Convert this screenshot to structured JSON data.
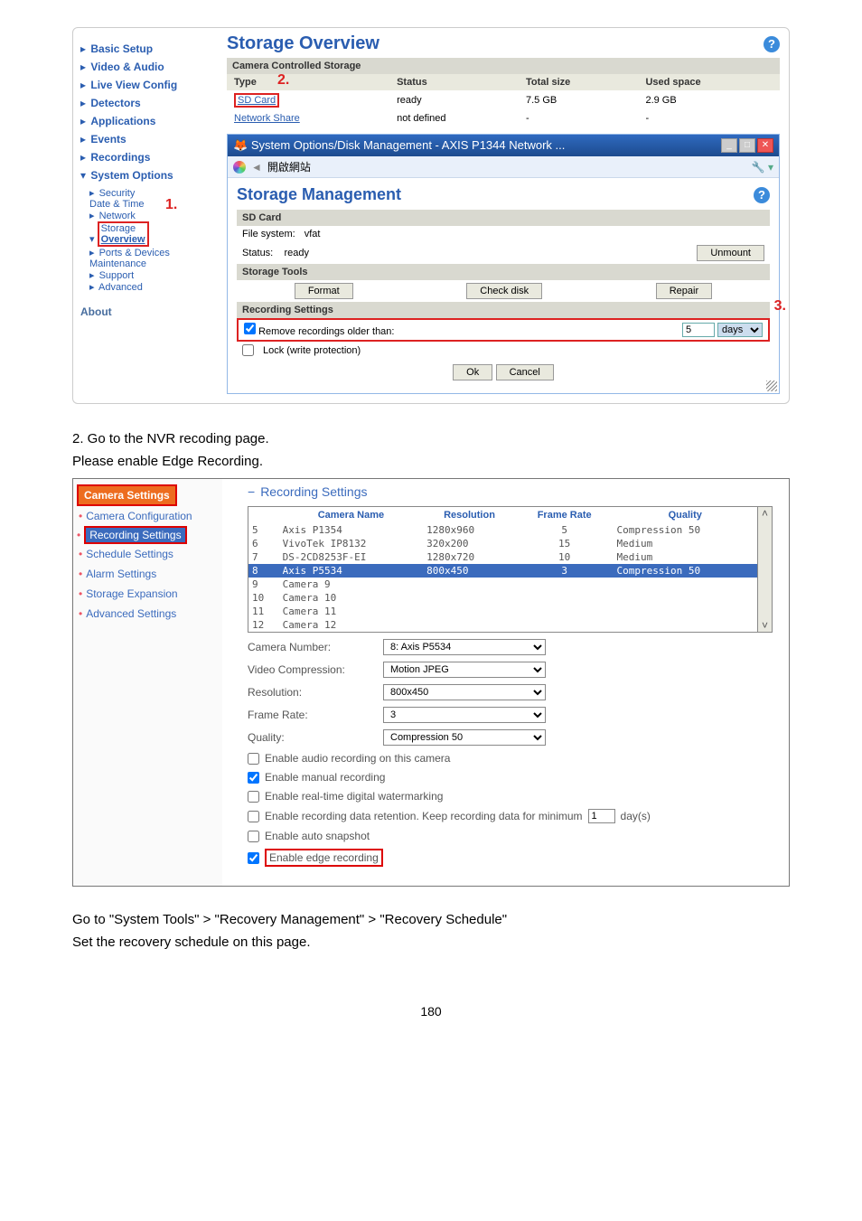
{
  "shot1": {
    "leftnav": {
      "items": [
        "Basic Setup",
        "Video & Audio",
        "Live View Config",
        "Detectors",
        "Applications",
        "Events",
        "Recordings"
      ],
      "sysopt_label": "System Options",
      "sysopt_children": {
        "security": "Security",
        "datetime": "Date & Time",
        "network": "Network",
        "storage": "Storage",
        "overview": "Overview",
        "ports": "Ports & Devices",
        "maintenance": "Maintenance",
        "support": "Support",
        "advanced": "Advanced"
      },
      "about": "About"
    },
    "title": "Storage Overview",
    "cam_storage_hdr": "Camera Controlled Storage",
    "table": {
      "headers": [
        "Type",
        "Status",
        "Total size",
        "Used space"
      ],
      "rows": [
        {
          "type": "SD Card",
          "status": "ready",
          "total": "7.5 GB",
          "used": "2.9 GB"
        },
        {
          "type": "Network Share",
          "status": "not defined",
          "total": "-",
          "used": "-"
        }
      ]
    },
    "anno2": "2.",
    "anno1": "1.",
    "anno3": "3.",
    "dialog": {
      "title": "System Options/Disk Management - AXIS P1344 Network ...",
      "toolbar_label": "開啟網站",
      "mgmt_title": "Storage Management",
      "sdcard_hdr": "SD Card",
      "fs_label": "File system:",
      "fs_value": "vfat",
      "status_label": "Status:",
      "status_value": "ready",
      "unmount_btn": "Unmount",
      "tools_hdr": "Storage Tools",
      "format_btn": "Format",
      "check_btn": "Check disk",
      "repair_btn": "Repair",
      "rec_hdr": "Recording Settings",
      "remove_label": "Remove recordings older than:",
      "remove_value": "5",
      "remove_unit": "days",
      "lock_label": "Lock (write protection)",
      "ok": "Ok",
      "cancel": "Cancel"
    }
  },
  "bodytext": {
    "line1": "2. Go to the NVR recoding page.",
    "line2": "Please enable Edge Recording."
  },
  "shot2": {
    "leftnav": {
      "hdr": "Camera Settings",
      "items": [
        "Camera Configuration",
        "Recording Settings",
        "Schedule Settings",
        "Alarm Settings",
        "Storage Expansion",
        "Advanced Settings"
      ],
      "selected_index": 1
    },
    "rec_hdr": "Recording Settings",
    "table": {
      "headers": [
        "",
        "Camera Name",
        "Resolution",
        "Frame Rate",
        "Quality"
      ],
      "rows": [
        {
          "n": "5",
          "name": "Axis P1354",
          "res": "1280x960",
          "fr": "5",
          "q": "Compression 50"
        },
        {
          "n": "6",
          "name": "VivoTek IP8132",
          "res": "320x200",
          "fr": "15",
          "q": "Medium"
        },
        {
          "n": "7",
          "name": "DS-2CD8253F-EI",
          "res": "1280x720",
          "fr": "10",
          "q": "Medium"
        },
        {
          "n": "8",
          "name": "Axis P5534",
          "res": "800x450",
          "fr": "3",
          "q": "Compression 50"
        },
        {
          "n": "9",
          "name": "Camera 9",
          "res": "",
          "fr": "",
          "q": ""
        },
        {
          "n": "10",
          "name": "Camera 10",
          "res": "",
          "fr": "",
          "q": ""
        },
        {
          "n": "11",
          "name": "Camera 11",
          "res": "",
          "fr": "",
          "q": ""
        },
        {
          "n": "12",
          "name": "Camera 12",
          "res": "",
          "fr": "",
          "q": ""
        }
      ],
      "sel_index": 3
    },
    "form": {
      "camnum_lbl": "Camera Number:",
      "camnum_val": "8: Axis P5534",
      "vcomp_lbl": "Video Compression:",
      "vcomp_val": "Motion JPEG",
      "res_lbl": "Resolution:",
      "res_val": "800x450",
      "fr_lbl": "Frame Rate:",
      "fr_val": "3",
      "q_lbl": "Quality:",
      "q_val": "Compression 50"
    },
    "checks": {
      "audio": "Enable audio recording on this camera",
      "manual": "Enable manual recording",
      "watermark": "Enable real-time digital watermarking",
      "retention_a": "Enable recording data retention. Keep recording data for minimum",
      "retention_val": "1",
      "retention_b": "day(s)",
      "autosnap": "Enable auto snapshot",
      "edge": "Enable edge recording"
    }
  },
  "footer": {
    "line1_a": "Go to \"System Tools\" > ",
    "line1_b": "\"Recovery Management\" > ",
    "line1_c": "\"Recovery Schedule\"",
    "line2": "Set the recovery schedule on this page."
  },
  "pgnum": "180"
}
